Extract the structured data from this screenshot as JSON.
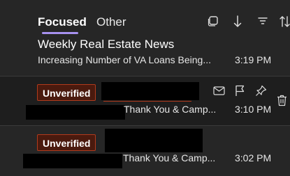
{
  "tabs": {
    "focused": "Focused",
    "other": "Other"
  },
  "toolbar": {
    "icons": [
      "select-icon",
      "sort-arrow-icon",
      "filter-icon",
      "sort-order-icon"
    ]
  },
  "messages": [
    {
      "sender": "Weekly Real Estate News",
      "subject": "Increasing Number of VA Loans Being...",
      "time": "3:19 PM"
    },
    {
      "badge": "Unverified",
      "subject": "Thank You & Camp...",
      "time": "3:10 PM",
      "hover_actions": [
        "mail-icon",
        "flag-icon",
        "pin-icon",
        "delete-icon"
      ]
    },
    {
      "badge": "Unverified",
      "subject": "Thank You & Camp...",
      "time": "3:02 PM"
    }
  ],
  "colors": {
    "background": "#1f1f1f",
    "accent": "#a791ef",
    "badge_border": "#b23a1c",
    "badge_fill": "#4a1a0e"
  }
}
